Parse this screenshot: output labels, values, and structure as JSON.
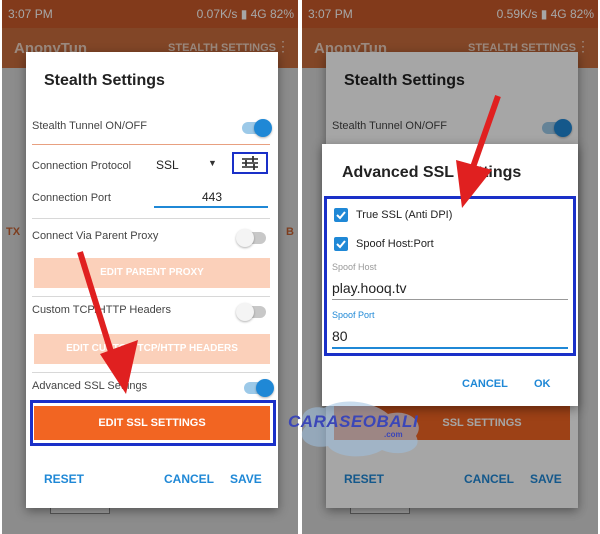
{
  "status_left": {
    "time": "3:07 PM",
    "right": "0.07K/s  ▮ 4G  82%"
  },
  "status_right": {
    "time": "3:07 PM",
    "right": "0.59K/s  ▮ 4G  82%"
  },
  "appbar": {
    "title": "AnonyTun",
    "menu": "STEALTH SETTINGS"
  },
  "bg_side": {
    "left_label": "TX",
    "right_label": "B"
  },
  "findout_label": "Find out more",
  "stealth_dialog": {
    "title": "Stealth Settings",
    "tunnel_label": "Stealth Tunnel ON/OFF",
    "tunnel_on": true,
    "protocol_label": "Connection Protocol",
    "protocol_value": "SSL",
    "port_label": "Connection Port",
    "port_value": "443",
    "proxy_label": "Connect Via Parent Proxy",
    "proxy_on": false,
    "edit_proxy_label": "EDIT PARENT PROXY",
    "headers_label": "Custom TCP/HTTP Headers",
    "headers_on": false,
    "edit_headers_label": "EDIT CUSTOM TCP/HTTP HEADERS",
    "ssl_label": "Advanced SSL Settings",
    "ssl_on": true,
    "edit_ssl_label": "EDIT SSL SETTINGS",
    "reset_label": "RESET",
    "cancel_label": "CANCEL",
    "save_label": "SAVE"
  },
  "right_bg": {
    "dialog_title": "Stealth Settings",
    "tunnel_label": "Stealth Tunnel ON/OFF",
    "ssl_btn_label": "SSL SETTINGS",
    "reset_label": "RESET",
    "cancel_label": "CANCEL",
    "save_label": "SAVE"
  },
  "advanced_dialog": {
    "title": "Advanced SSL Settings",
    "true_ssl_label": "True SSL (Anti DPI)",
    "true_ssl_checked": true,
    "spoof_label": "Spoof Host:Port",
    "spoof_checked": true,
    "spoof_host_label": "Spoof Host",
    "spoof_host_value": "play.hooq.tv",
    "spoof_port_label": "Spoof Port",
    "spoof_port_value": "80",
    "cancel_label": "CANCEL",
    "ok_label": "OK"
  },
  "watermark": {
    "text": "CARASEOBALI",
    "sub": ".com"
  },
  "colors": {
    "accent": "#f26522",
    "primary": "#1f88d6",
    "highlight": "#1a30c8",
    "arrow": "#e02020"
  }
}
